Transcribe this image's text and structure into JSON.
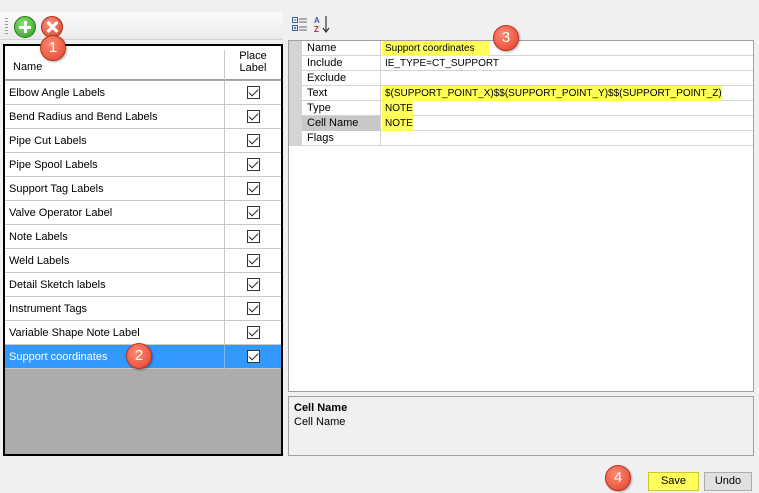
{
  "toolbar": {
    "add_icon": "add-green-plus-icon",
    "delete_icon": "delete-red-x-icon"
  },
  "callouts": [
    "1",
    "2",
    "3",
    "4"
  ],
  "label_list": {
    "columns": {
      "name": "Name",
      "place": "Place\nLabel"
    },
    "rows": [
      {
        "name": "Elbow Angle Labels",
        "checked": true
      },
      {
        "name": "Bend Radius and Bend Labels",
        "checked": true
      },
      {
        "name": "Pipe Cut Labels",
        "checked": true
      },
      {
        "name": "Pipe Spool Labels",
        "checked": true
      },
      {
        "name": "Support Tag Labels",
        "checked": true
      },
      {
        "name": "Valve Operator Label",
        "checked": true
      },
      {
        "name": "Note Labels",
        "checked": true
      },
      {
        "name": "Weld Labels",
        "checked": true
      },
      {
        "name": "Detail Sketch labels",
        "checked": true
      },
      {
        "name": "Instrument Tags",
        "checked": true
      },
      {
        "name": "Variable Shape Note Label",
        "checked": true
      },
      {
        "name": "Support coordinates",
        "checked": true,
        "selected": true
      }
    ]
  },
  "properties": [
    {
      "label": "Name",
      "value": "Support coordinates",
      "highlight": true
    },
    {
      "label": "Include",
      "value": "IE_TYPE=CT_SUPPORT",
      "highlight": false
    },
    {
      "label": "Exclude",
      "value": "",
      "highlight": false
    },
    {
      "label": "Text",
      "value": "$(SUPPORT_POINT_X)$$(SUPPORT_POINT_Y)$$(SUPPORT_POINT_Z)",
      "highlight": true
    },
    {
      "label": "Type",
      "value": "NOTE",
      "highlight": true
    },
    {
      "label": "Cell Name",
      "value": "NOTE",
      "highlight": true,
      "selected": true
    },
    {
      "label": "Flags",
      "value": "",
      "highlight": false
    }
  ],
  "description": {
    "title": "Cell Name",
    "text": "Cell Name"
  },
  "buttons": {
    "save": "Save",
    "undo": "Undo"
  },
  "colors": {
    "highlight": "#ffff5a",
    "selection": "#3399ff",
    "callout": "#e0412a"
  }
}
